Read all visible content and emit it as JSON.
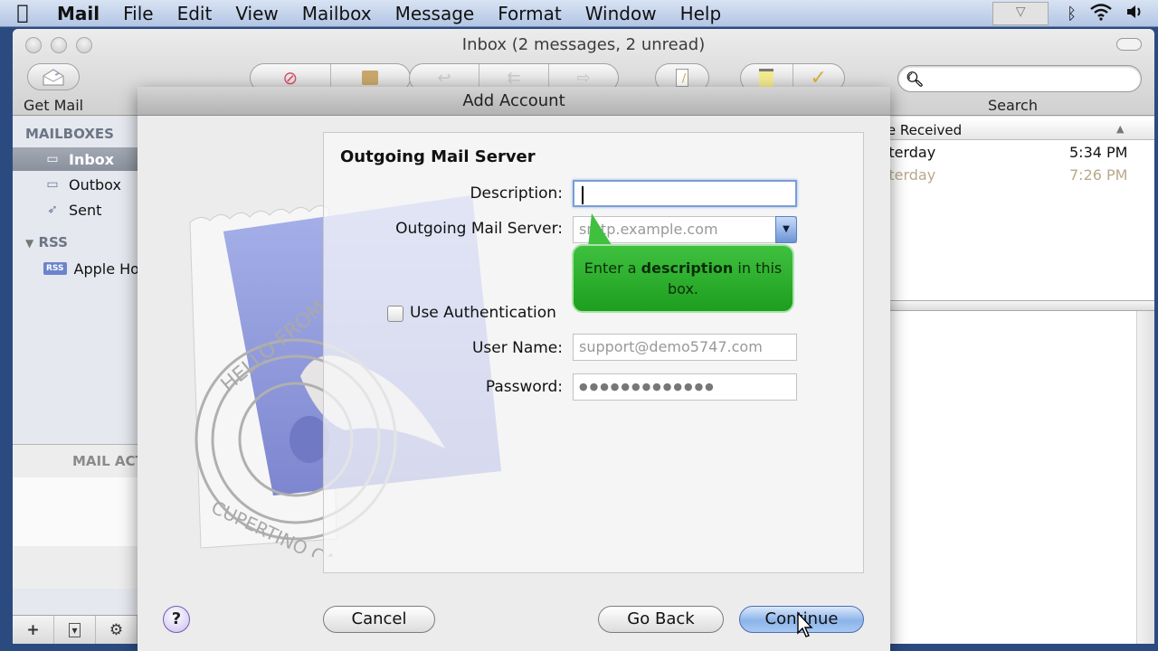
{
  "menubar": {
    "apple_icon": "apple-icon",
    "items": [
      "Mail",
      "File",
      "Edit",
      "View",
      "Mailbox",
      "Message",
      "Format",
      "Window",
      "Help"
    ],
    "status_icons": [
      "display-extra-icon",
      "bluetooth-icon",
      "wifi-icon",
      "volume-icon"
    ]
  },
  "window": {
    "title": "Inbox (2 messages, 2 unread)",
    "toolbar": {
      "get_mail": "Get Mail",
      "search_label": "Search",
      "search_placeholder": "",
      "groups": [
        [
          "delete-icon",
          "junk-icon"
        ],
        [
          "reply-icon",
          "reply-all-icon",
          "forward-icon"
        ],
        [
          "new-message-icon"
        ],
        [
          "note-icon",
          "todo-icon"
        ]
      ]
    }
  },
  "sidebar": {
    "header": "MAILBOXES",
    "mailboxes": [
      {
        "label": "Inbox",
        "icon": "inbox-icon",
        "selected": true
      },
      {
        "label": "Outbox",
        "icon": "outbox-icon",
        "selected": false
      },
      {
        "label": "Sent",
        "icon": "sent-icon",
        "selected": false
      }
    ],
    "rss_header": "RSS",
    "rss_feeds": [
      {
        "label": "Apple Hot",
        "badge": "RSS"
      }
    ],
    "activity_title": "MAIL ACT",
    "bottom_buttons": [
      "+",
      "▾",
      "⚙"
    ]
  },
  "message_list": {
    "date_column": "te Received",
    "sort_glyph": "▲",
    "rows": [
      {
        "date": "sterday",
        "time": "5:34 PM",
        "read": false
      },
      {
        "date": "sterday",
        "time": "7:26 PM",
        "read": true
      }
    ]
  },
  "sheet": {
    "title": "Add Account",
    "section_title": "Outgoing Mail Server",
    "description_label": "Description:",
    "description_value": "",
    "server_label": "Outgoing Mail Server:",
    "server_placeholder": "smtp.example.com",
    "use_auth_label": "Use Authentication",
    "use_auth_checked": false,
    "username_label": "User Name:",
    "username_value": "support@demo5747.com",
    "password_label": "Password:",
    "password_value": "●●●●●●●●●●●●●",
    "tooltip_prefix": "Enter a ",
    "tooltip_bold": "description",
    "tooltip_suffix": " in this box.",
    "help_label": "?",
    "cancel_label": "Cancel",
    "goback_label": "Go Back",
    "continue_label": "Continue",
    "stamp_text_top": "HELLO FROM",
    "stamp_text_bottom": "CUPERTINO CA"
  },
  "colors": {
    "tooltip_green": "#2cad2c",
    "default_button_blue": "#8cb4ea",
    "read_message_text": "#b8a98a",
    "desktop": "#2b4a80"
  }
}
